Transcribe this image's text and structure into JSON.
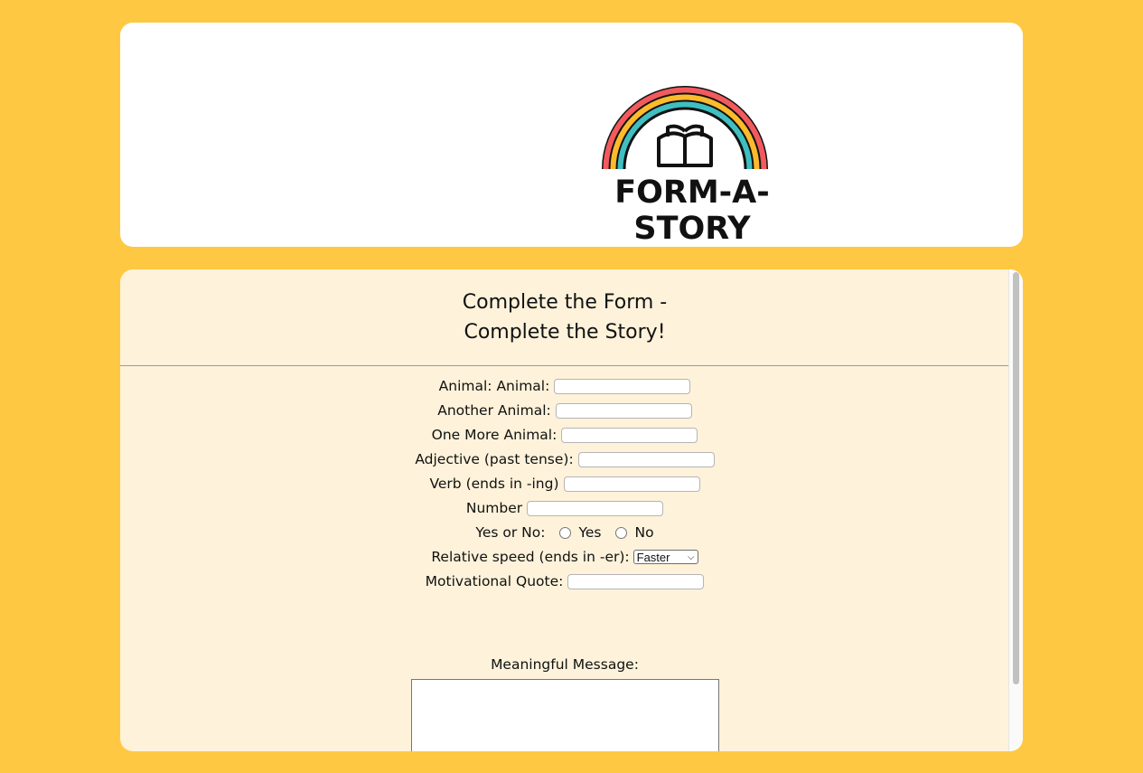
{
  "logo": {
    "text": "FORM-A-STORY"
  },
  "form": {
    "title_line1": "Complete the Form -",
    "title_line2": "Complete the Story!",
    "fields": {
      "animal": "Animal: Animal:",
      "another_animal": "Another Animal:",
      "one_more_animal": "One More Animal:",
      "adjective": "Adjective (past tense):",
      "verb": "Verb (ends in -ing)",
      "number": "Number",
      "yes_no": "Yes or No:",
      "yes": "Yes",
      "no": "No",
      "relative_speed": "Relative speed (ends in -er):",
      "relative_speed_selected": "Faster",
      "motivational_quote": "Motivational Quote:",
      "meaningful_message": "Meaningful Message:"
    }
  },
  "colors": {
    "page_background": "#FFC843",
    "form_background": "#FEF2DA",
    "rainbow_red": "#F25A5E",
    "rainbow_yellow": "#FDBA2C",
    "rainbow_teal": "#3FBFC1"
  }
}
